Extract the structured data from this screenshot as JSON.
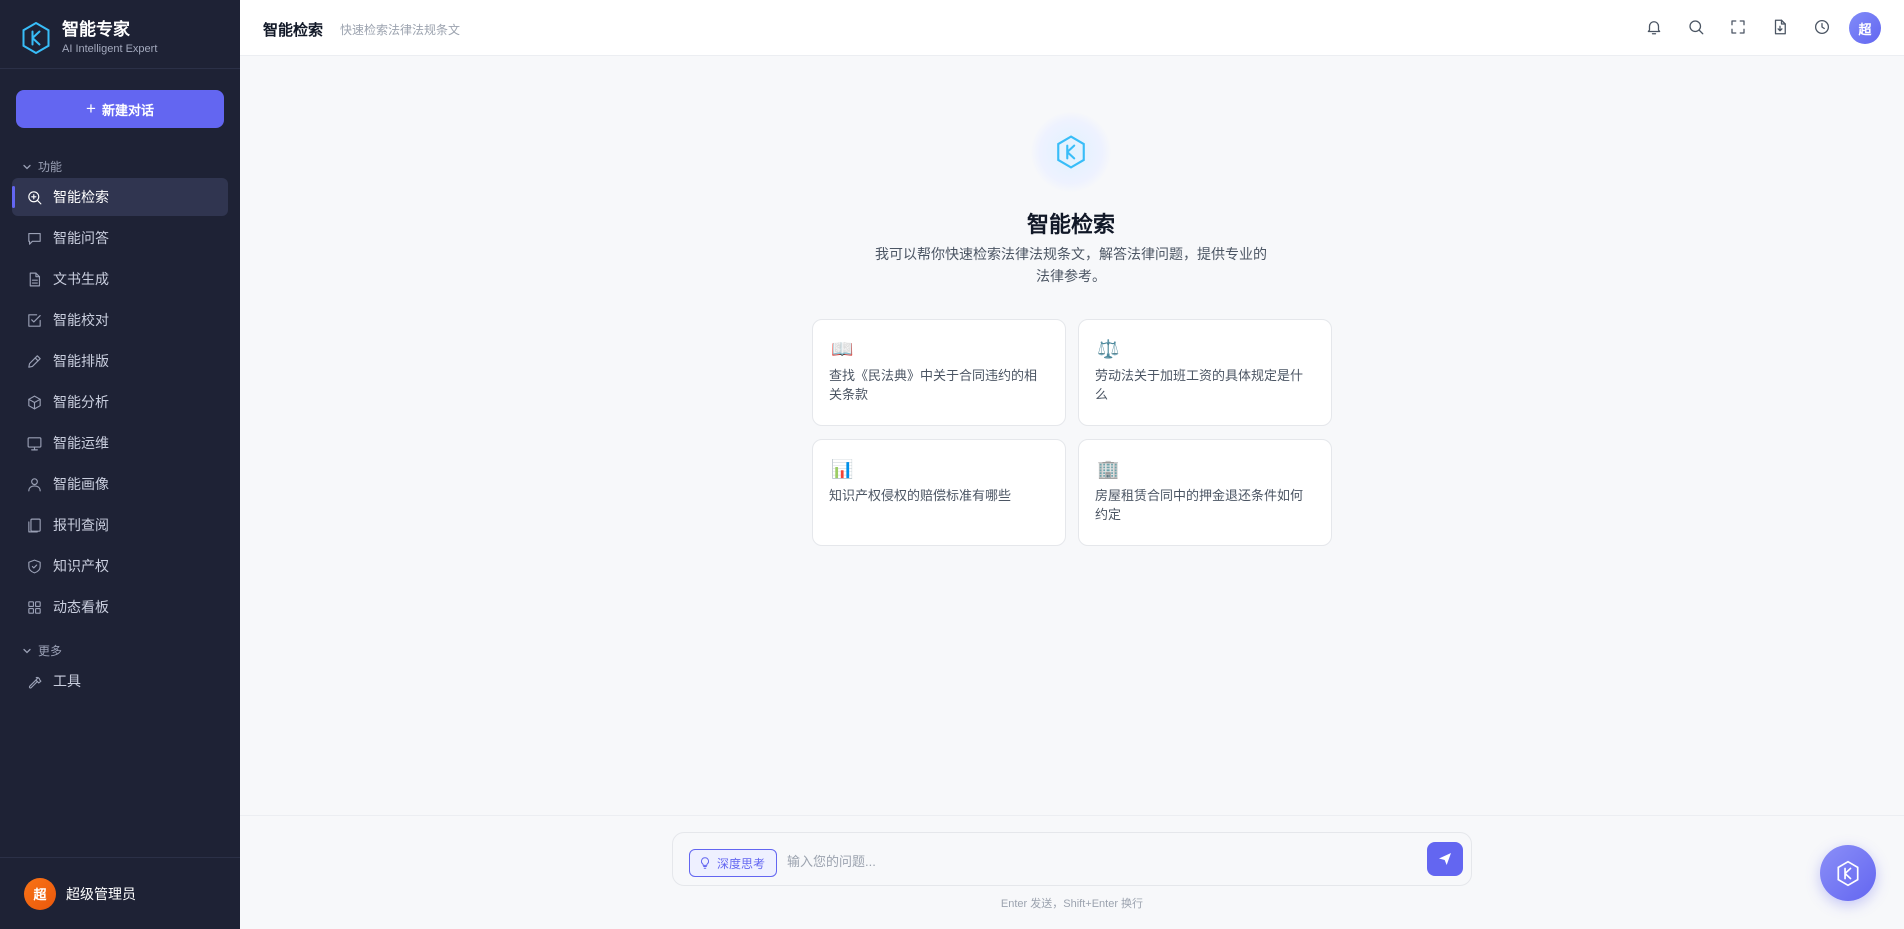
{
  "brand": {
    "title": "智能专家",
    "subtitle": "AI Intelligent Expert"
  },
  "sidebar": {
    "new_chat_label": "新建对话",
    "section_features": "功能",
    "section_more": "更多",
    "items": [
      {
        "label": "智能检索",
        "icon": "search-doc-icon",
        "active": true
      },
      {
        "label": "智能问答",
        "icon": "chat-bubble-icon"
      },
      {
        "label": "文书生成",
        "icon": "document-icon"
      },
      {
        "label": "智能校对",
        "icon": "check-square-icon"
      },
      {
        "label": "智能排版",
        "icon": "pen-icon"
      },
      {
        "label": "智能分析",
        "icon": "cube-icon"
      },
      {
        "label": "智能运维",
        "icon": "monitor-icon"
      },
      {
        "label": "智能画像",
        "icon": "user-icon"
      },
      {
        "label": "报刊查阅",
        "icon": "pages-icon"
      },
      {
        "label": "知识产权",
        "icon": "shield-icon"
      },
      {
        "label": "动态看板",
        "icon": "grid-icon"
      }
    ],
    "more_items": [
      {
        "label": "工具",
        "icon": "wrench-icon"
      }
    ]
  },
  "user": {
    "avatar_text": "超",
    "name": "超级管理员"
  },
  "header": {
    "title": "智能检索",
    "subtitle": "快速检索法律法规条文",
    "avatar_text": "超",
    "icons": [
      "bell-icon",
      "search-icon",
      "fullscreen-icon",
      "download-file-icon",
      "history-clock-icon"
    ]
  },
  "hero": {
    "title": "智能检索",
    "description": "我可以帮你快速检索法律法规条文，解答法律问题，提供专业的法律参考。"
  },
  "suggestions": [
    {
      "emoji": "📖",
      "text": "查找《民法典》中关于合同违约的相关条款"
    },
    {
      "emoji": "⚖️",
      "text": "劳动法关于加班工资的具体规定是什么"
    },
    {
      "emoji": "📊",
      "text": "知识产权侵权的赔偿标准有哪些"
    },
    {
      "emoji": "🏢",
      "text": "房屋租赁合同中的押金退还条件如何约定"
    }
  ],
  "input": {
    "deep_think_label": "深度思考",
    "placeholder": "输入您的问题...",
    "value": "",
    "hint": "Enter 发送，Shift+Enter 换行"
  },
  "colors": {
    "accent": "#6366f1",
    "sidebar_bg": "#1e2235",
    "page_bg": "#f7f8fa"
  }
}
